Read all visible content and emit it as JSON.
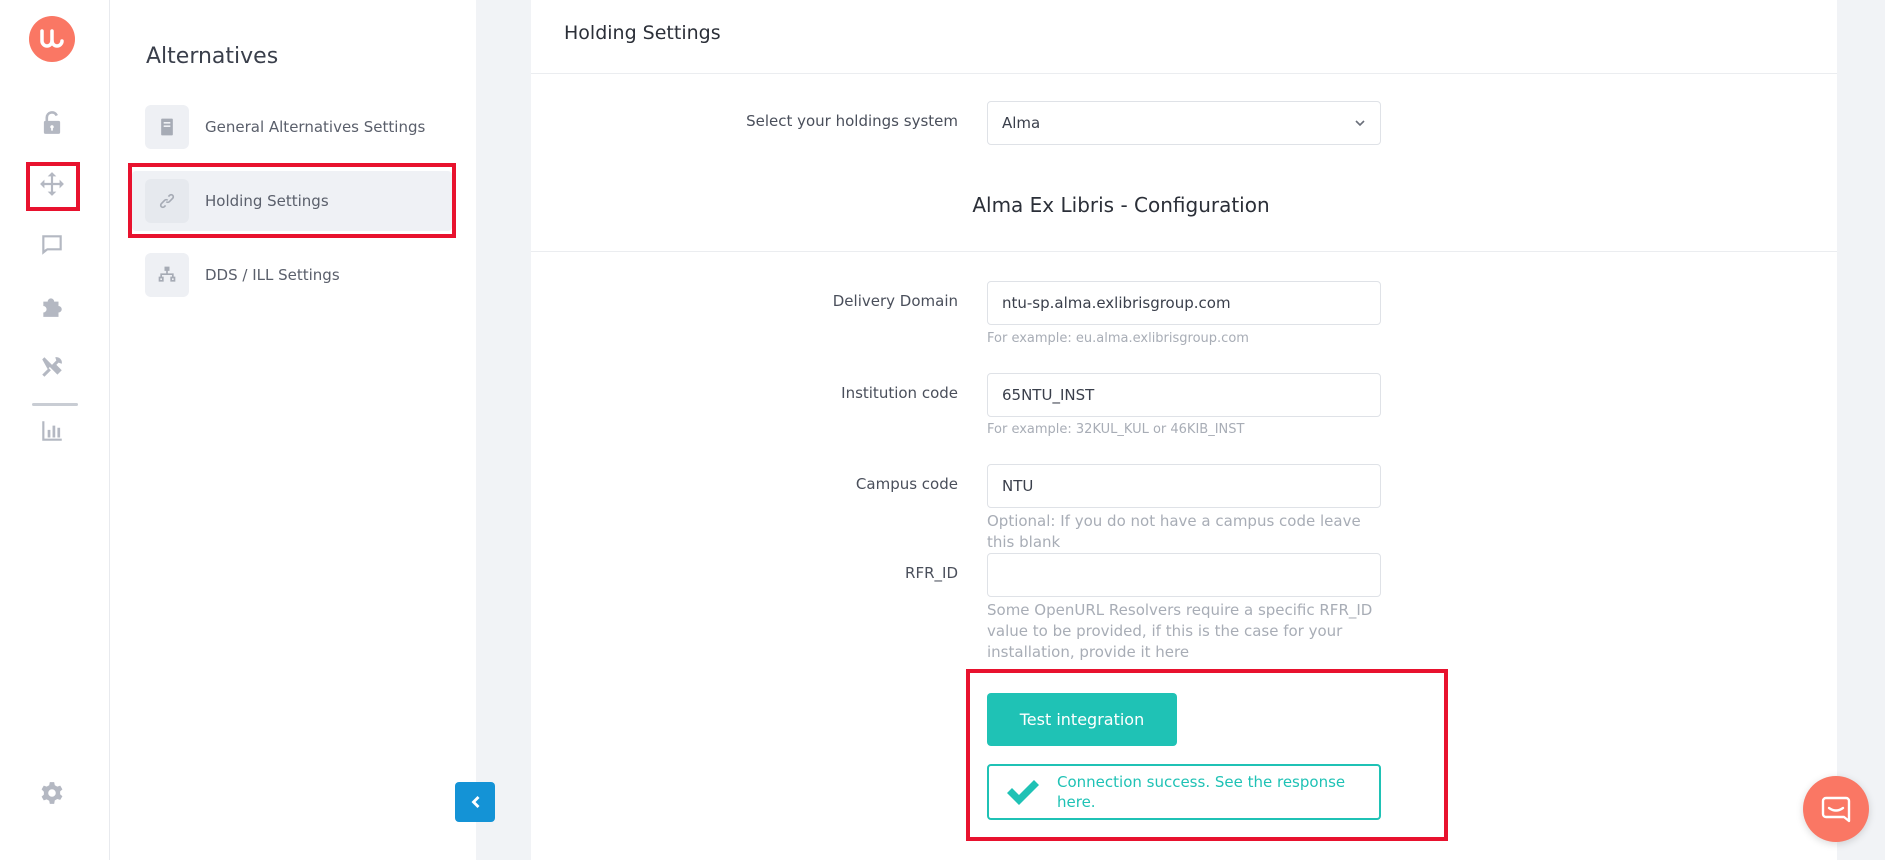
{
  "rail": {
    "logo_icon": "logo-icon",
    "icons": [
      "unlock-icon",
      "move-arrows-icon",
      "chat-icon",
      "puzzle-icon",
      "tools-icon",
      "bar-chart-icon",
      "gear-icon"
    ]
  },
  "submenu": {
    "title": "Alternatives",
    "items": [
      {
        "label": "General Alternatives Settings",
        "icon": "book-icon"
      },
      {
        "label": "Holding Settings",
        "icon": "link-icon"
      },
      {
        "label": "DDS / ILL Settings",
        "icon": "sitemap-icon"
      }
    ]
  },
  "main": {
    "title": "Holding Settings",
    "holdings_label": "Select your holdings system",
    "holdings_value": "Alma",
    "section_title": "Alma Ex Libris - Configuration",
    "fields": [
      {
        "label": "Delivery Domain",
        "value": "ntu-sp.alma.exlibrisgroup.com",
        "help": "For example: eu.alma.exlibrisgroup.com"
      },
      {
        "label": "Institution code",
        "value": "65NTU_INST",
        "help": "For example: 32KUL_KUL or 46KIB_INST"
      },
      {
        "label": "Campus code",
        "value": "NTU",
        "help": "Optional: If you do not have a campus code leave this blank"
      },
      {
        "label": "RFR_ID",
        "value": "",
        "help": "Some OpenURL Resolvers require a specific RFR_ID value to be provided, if this is the case for your installation, provide it here"
      }
    ],
    "test_button": "Test integration",
    "success_message": "Connection success. See the response here."
  },
  "colors": {
    "accent": "#1fc2b5",
    "brand": "#fa7764",
    "highlight": "#e8122e",
    "collapse": "#1493d6"
  }
}
